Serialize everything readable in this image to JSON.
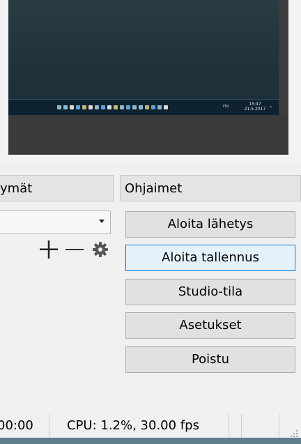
{
  "preview": {
    "taskbar": {
      "clock_time": "15:47",
      "clock_date": "21.5.2017",
      "lang": "FIN"
    }
  },
  "scenes_header": "ymät",
  "controls": {
    "header": "Ohjaimet",
    "start_streaming": "Aloita lähetys",
    "start_recording": "Aloita tallennus",
    "studio_mode": "Studio-tila",
    "settings": "Asetukset",
    "exit": "Poistu"
  },
  "status": {
    "time": "00:00",
    "cpu": "CPU: 1.2%, 30.00 fps"
  },
  "colors": {
    "focus_border": "#0078d7",
    "focus_fill": "#e5f1fb"
  },
  "icons": [
    "plus-icon",
    "minus-icon",
    "gear-icon",
    "dropdown-arrow-icon"
  ]
}
